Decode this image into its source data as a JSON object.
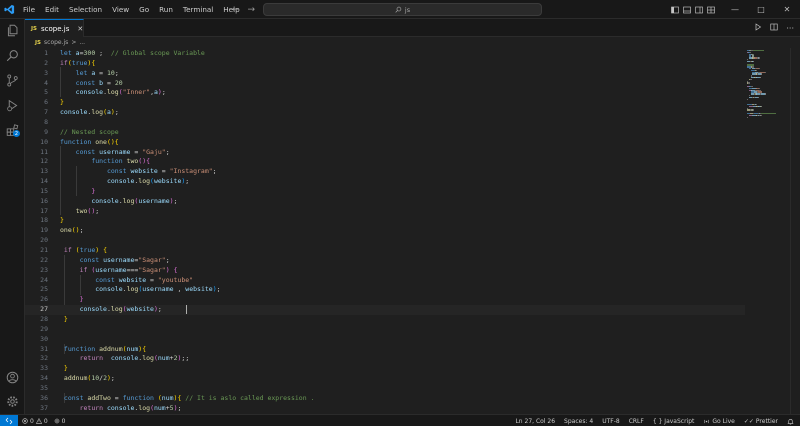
{
  "menu": [
    "File",
    "Edit",
    "Selection",
    "View",
    "Go",
    "Run",
    "Terminal",
    "Help"
  ],
  "search": {
    "text": "js"
  },
  "tab": {
    "badge": "JS",
    "label": "scope.js"
  },
  "breadcrumb": {
    "badge": "JS",
    "file": "scope.js",
    "sep": ">",
    "more": "..."
  },
  "editor": {
    "active_line": 27,
    "lines": [
      [
        [
          "kw",
          "let "
        ],
        [
          "var",
          "a"
        ],
        [
          "",
          "="
        ],
        [
          "num",
          "300"
        ],
        [
          "",
          " ;  "
        ],
        [
          "cm",
          "// Global scope Variable"
        ]
      ],
      [
        [
          "ctl",
          "if"
        ],
        [
          "br1",
          "("
        ],
        [
          "kw",
          "true"
        ],
        [
          "br1",
          "){"
        ]
      ],
      [
        [
          "",
          "    "
        ],
        [
          "kw",
          "let "
        ],
        [
          "var",
          "a"
        ],
        [
          "",
          " = "
        ],
        [
          "num",
          "10"
        ],
        [
          "",
          ";"
        ]
      ],
      [
        [
          "",
          "    "
        ],
        [
          "kw",
          "const "
        ],
        [
          "var",
          "b"
        ],
        [
          "",
          " = "
        ],
        [
          "num",
          "20"
        ]
      ],
      [
        [
          "",
          "    "
        ],
        [
          "var",
          "console"
        ],
        [
          "",
          "."
        ],
        [
          "fn",
          "log"
        ],
        [
          "br2",
          "("
        ],
        [
          "str",
          "\"Inner\""
        ],
        [
          "",
          ","
        ],
        [
          "var",
          "a"
        ],
        [
          "br2",
          ")"
        ],
        [
          "",
          ";"
        ]
      ],
      [
        [
          "br1",
          "}"
        ]
      ],
      [
        [
          "var",
          "console"
        ],
        [
          "",
          "."
        ],
        [
          "fn",
          "log"
        ],
        [
          "br1",
          "("
        ],
        [
          "var",
          "a"
        ],
        [
          "br1",
          ")"
        ],
        [
          "",
          ";"
        ]
      ],
      [],
      [
        [
          "cm",
          "// Nested scope"
        ]
      ],
      [
        [
          "kw",
          "function "
        ],
        [
          "fn",
          "one"
        ],
        [
          "br1",
          "(){"
        ]
      ],
      [
        [
          "",
          "    "
        ],
        [
          "kw",
          "const "
        ],
        [
          "var",
          "username"
        ],
        [
          "",
          " = "
        ],
        [
          "str",
          "\"Gaju\""
        ],
        [
          "",
          ";"
        ]
      ],
      [
        [
          "",
          "        "
        ],
        [
          "kw",
          "function "
        ],
        [
          "fn",
          "two"
        ],
        [
          "br2",
          "(){"
        ]
      ],
      [
        [
          "",
          "            "
        ],
        [
          "kw",
          "const "
        ],
        [
          "var",
          "website"
        ],
        [
          "",
          " = "
        ],
        [
          "str",
          "\"Instagram\""
        ],
        [
          "",
          ";"
        ]
      ],
      [
        [
          "",
          "            "
        ],
        [
          "var",
          "console"
        ],
        [
          "",
          "."
        ],
        [
          "fn",
          "log"
        ],
        [
          "br3",
          "("
        ],
        [
          "var",
          "website"
        ],
        [
          "br3",
          ")"
        ],
        [
          "",
          ";"
        ]
      ],
      [
        [
          "",
          "        "
        ],
        [
          "br2",
          "}"
        ]
      ],
      [
        [
          "",
          "        "
        ],
        [
          "var",
          "console"
        ],
        [
          "",
          "."
        ],
        [
          "fn",
          "log"
        ],
        [
          "br2",
          "("
        ],
        [
          "var",
          "username"
        ],
        [
          "br2",
          ")"
        ],
        [
          "",
          ";"
        ]
      ],
      [
        [
          "",
          "    "
        ],
        [
          "fn",
          "two"
        ],
        [
          "br2",
          "()"
        ],
        [
          "",
          ";"
        ]
      ],
      [
        [
          "br1",
          "}"
        ]
      ],
      [
        [
          "fn",
          "one"
        ],
        [
          "br1",
          "()"
        ],
        [
          "",
          ";"
        ]
      ],
      [],
      [
        [
          "ctl",
          " if "
        ],
        [
          "br1",
          "("
        ],
        [
          "kw",
          "true"
        ],
        [
          "br1",
          ")"
        ],
        [
          "",
          " "
        ],
        [
          "br1",
          "{"
        ]
      ],
      [
        [
          "",
          "     "
        ],
        [
          "kw",
          "const "
        ],
        [
          "var",
          "username"
        ],
        [
          "",
          "="
        ],
        [
          "str",
          "\"Sagar\""
        ],
        [
          "",
          ";"
        ]
      ],
      [
        [
          "",
          "     "
        ],
        [
          "ctl",
          "if "
        ],
        [
          "br2",
          "("
        ],
        [
          "var",
          "username"
        ],
        [
          "",
          "==="
        ],
        [
          "str",
          "\"Sagar\""
        ],
        [
          "br2",
          ")"
        ],
        [
          "",
          " "
        ],
        [
          "br2",
          "{"
        ]
      ],
      [
        [
          "",
          "         "
        ],
        [
          "kw",
          "const "
        ],
        [
          "var",
          "website"
        ],
        [
          "",
          " = "
        ],
        [
          "str",
          "\"youtube\""
        ]
      ],
      [
        [
          "",
          "         "
        ],
        [
          "var",
          "console"
        ],
        [
          "",
          "."
        ],
        [
          "fn",
          "log"
        ],
        [
          "br3",
          "("
        ],
        [
          "var",
          "username"
        ],
        [
          "",
          " , "
        ],
        [
          "var",
          "website"
        ],
        [
          "br3",
          ")"
        ],
        [
          "",
          ";"
        ]
      ],
      [
        [
          "",
          "     "
        ],
        [
          "br2",
          "}"
        ]
      ],
      [
        [
          "",
          "     "
        ],
        [
          "var",
          "console"
        ],
        [
          "",
          "."
        ],
        [
          "fn",
          "log"
        ],
        [
          "br2",
          "("
        ],
        [
          "var",
          "website"
        ],
        [
          "br2",
          ")"
        ],
        [
          "",
          ";"
        ]
      ],
      [
        [
          "br1",
          " }"
        ]
      ],
      [],
      [],
      [
        [
          "kw",
          " function "
        ],
        [
          "fn",
          "addnum"
        ],
        [
          "br1",
          "("
        ],
        [
          "var",
          "num"
        ],
        [
          "br1",
          "){"
        ]
      ],
      [
        [
          "",
          "     "
        ],
        [
          "ctl",
          "return  "
        ],
        [
          "var",
          "console"
        ],
        [
          "",
          "."
        ],
        [
          "fn",
          "log"
        ],
        [
          "br2",
          "("
        ],
        [
          "var",
          "num"
        ],
        [
          "",
          "+"
        ],
        [
          "num",
          "2"
        ],
        [
          "br2",
          ")"
        ],
        [
          "",
          ";;"
        ]
      ],
      [
        [
          "br1",
          " }"
        ]
      ],
      [
        [
          "fn",
          " addnum"
        ],
        [
          "br1",
          "("
        ],
        [
          "num",
          "10"
        ],
        [
          "",
          "/"
        ],
        [
          "num",
          "2"
        ],
        [
          "br1",
          ")"
        ],
        [
          "",
          ";"
        ]
      ],
      [],
      [
        [
          "kw",
          " const "
        ],
        [
          "fn",
          "addTwo"
        ],
        [
          "",
          " = "
        ],
        [
          "kw",
          "function "
        ],
        [
          "br1",
          "("
        ],
        [
          "var",
          "num"
        ],
        [
          "br1",
          "){"
        ],
        [
          "cm",
          " // It is aslo called expression ."
        ]
      ],
      [
        [
          "",
          "     "
        ],
        [
          "ctl",
          "return "
        ],
        [
          "var",
          "console"
        ],
        [
          "",
          "."
        ],
        [
          "fn",
          "log"
        ],
        [
          "br2",
          "("
        ],
        [
          "var",
          "num"
        ],
        [
          "",
          "+"
        ],
        [
          "num",
          "5"
        ],
        [
          "br2",
          ")"
        ],
        [
          "",
          ";"
        ]
      ],
      [
        [
          "br1",
          " }"
        ]
      ]
    ]
  },
  "status": {
    "errors": "0",
    "warnings": "0",
    "ports": "0",
    "position": "Ln 27, Col 26",
    "spaces": "Spaces: 4",
    "encoding": "UTF-8",
    "eol": "CRLF",
    "language_mode": "{ } JavaScript",
    "golive": "Go Live",
    "prettier": "Prettier"
  },
  "colors": {
    "accent": "#0078d4",
    "keyword": "#569cd6",
    "control": "#c586c0",
    "variable": "#9cdcfe",
    "function": "#dcdcaa",
    "string": "#ce9178",
    "number": "#b5cea8",
    "comment": "#6a9955"
  },
  "icons": [
    "vscode-logo-icon",
    "explorer-icon",
    "search-icon",
    "source-control-icon",
    "run-debug-icon",
    "extensions-icon",
    "account-icon",
    "manage-gear-icon",
    "lightbulb-icon",
    "bell-icon"
  ]
}
